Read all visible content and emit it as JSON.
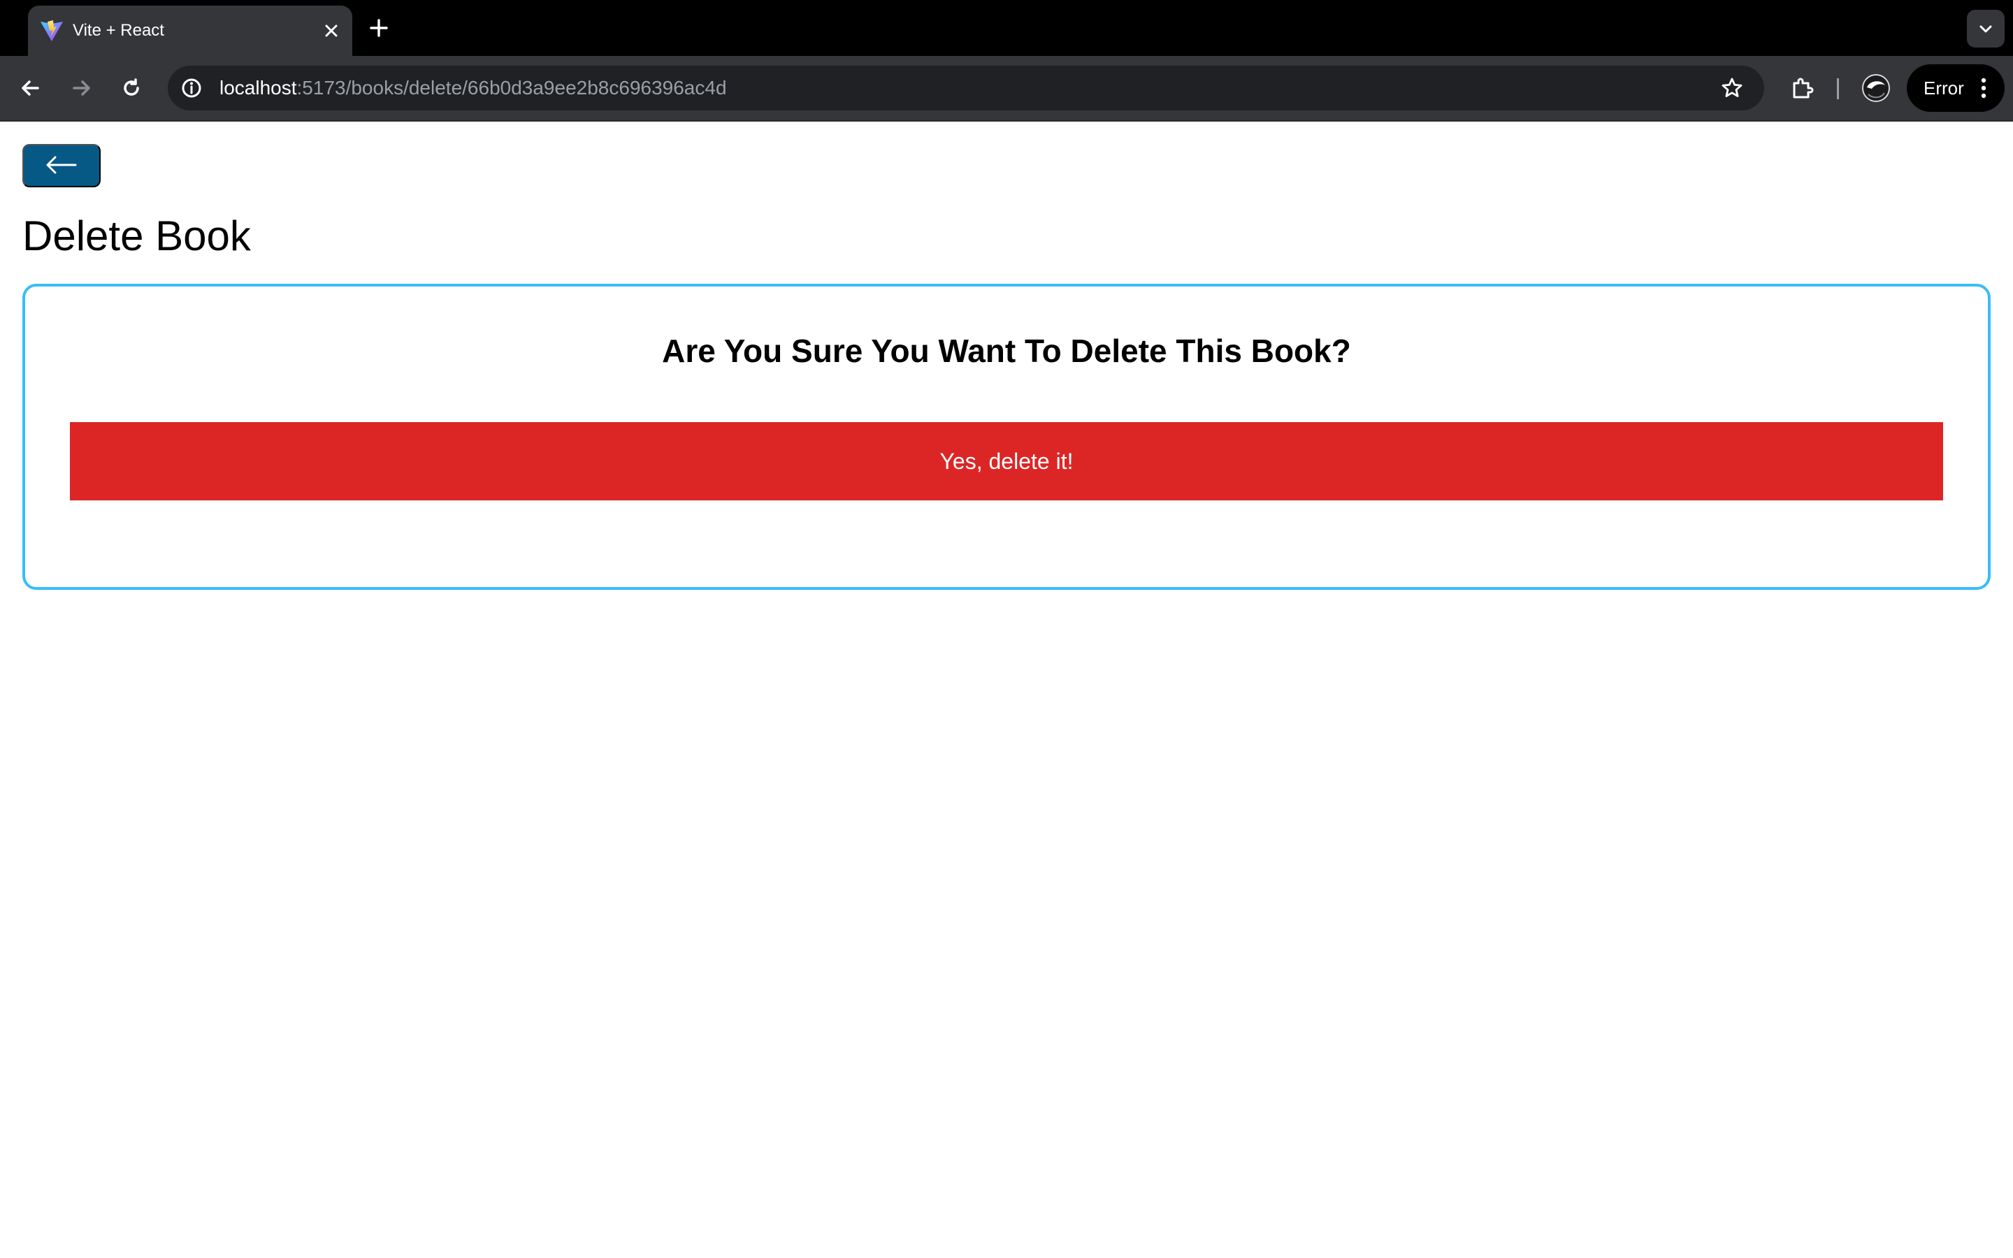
{
  "browser": {
    "tab": {
      "title": "Vite + React",
      "favicon": "vite-logo-icon"
    },
    "address_bar": {
      "host": "localhost",
      "path": ":5173/books/delete/66b0d3a9ee2b8c696396ac4d"
    },
    "profile_status": "Error"
  },
  "page": {
    "title": "Delete Book",
    "confirm_message": "Are You Sure You Want To Delete This Book?",
    "delete_button_label": "Yes, delete it!",
    "back_button_icon": "arrow-left-icon"
  },
  "colors": {
    "back_button": "#075985",
    "delete_button": "#dc2626",
    "card_border": "#38bdf8"
  }
}
